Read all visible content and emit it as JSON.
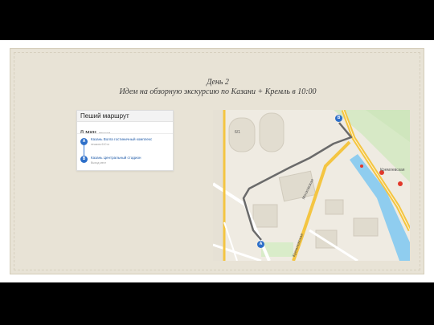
{
  "slide": {
    "title_line1": "День 2",
    "title_line2": "Идем на обзорную экскурсию по Казани + Кремль в 10:00"
  },
  "route_card": {
    "header": "Пеший маршрут",
    "time": "8 мин",
    "mode": "пешком",
    "stops": [
      {
        "marker": "A",
        "name": "Казань Волга гостиничный комплекс",
        "detail": "пешком 610 м"
      },
      {
        "marker": "B",
        "name": "Казань Центральный стадион",
        "detail": "Выход мест"
      }
    ]
  },
  "map": {
    "markers": [
      "A",
      "B"
    ],
    "labels": {
      "street_1": "Московская",
      "street_2": "Кремлевская",
      "poi_1": "Кремлевская",
      "building_num": "6/1"
    }
  },
  "colors": {
    "slide_frame": "#e8e3d6",
    "route_line": "#6a6a6a",
    "marker_blue": "#2d6fc9",
    "road_yellow": "#f4c542",
    "water": "#7fc3e8",
    "park": "#cfe6bd"
  }
}
